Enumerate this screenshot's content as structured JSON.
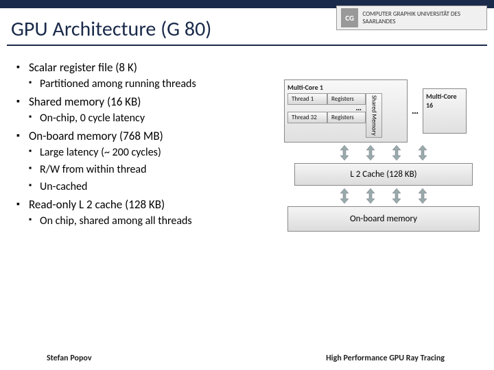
{
  "header": {
    "logo_text": "COMPUTER GRAPHIK UNIVERSITÄT DES SAARLANDES",
    "logo_badge": "CG"
  },
  "title": "GPU Architecture (G 80)",
  "bullets": {
    "b1": "Scalar register file (8 K)",
    "b1_1": "Partitioned among running threads",
    "b2": "Shared memory (16 KB)",
    "b2_1": "On-chip, 0 cycle latency",
    "b3": "On-board memory (768 MB)",
    "b3_1": "Large latency (~ 200 cycles)",
    "b3_2": "R/W from within thread",
    "b3_3": "Un-cached",
    "b4": "Read-only L 2 cache (128 KB)",
    "b4_1": "On chip, shared among all threads"
  },
  "diagram": {
    "core1_label": "Multi-Core 1",
    "core16_label": "Multi-Core 16",
    "thread1": "Thread 1",
    "thread32": "Thread 32",
    "registers": "Registers",
    "shared_mem": "Shared Memory",
    "dots": "…",
    "between": "…",
    "l2": "L 2 Cache (128 KB)",
    "onboard": "On-board memory"
  },
  "footer": {
    "author": "Stefan Popov",
    "credit": "High Performance GPU Ray Tracing"
  }
}
